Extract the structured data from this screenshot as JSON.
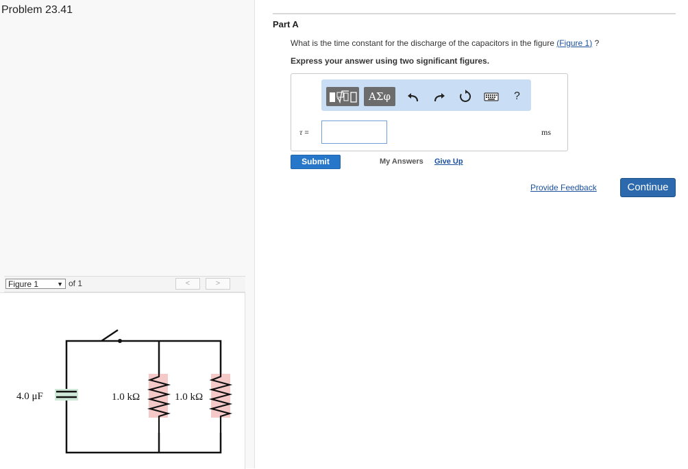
{
  "problem": {
    "title": "Problem 23.41"
  },
  "figure_nav": {
    "selected": "Figure 1",
    "of_text": "of 1",
    "prev": "<",
    "next": ">"
  },
  "circuit": {
    "capacitor_label": "4.0 μF",
    "resistor1_label": "1.0 kΩ",
    "resistor2_label": "1.0 kΩ"
  },
  "part": {
    "label": "Part A",
    "question_before": "What is the time constant for the discharge of the capacitors in the figure ",
    "question_link_open": "(",
    "question_link": "Figure 1",
    "question_link_close": ")",
    "question_after": " ?",
    "instruction": "Express your answer using two significant figures."
  },
  "answer": {
    "greek_label": "ΑΣφ",
    "help_label": "?",
    "variable": "τ",
    "equals": "=",
    "value": "",
    "unit": "ms"
  },
  "actions": {
    "submit": "Submit",
    "my_answers": "My Answers",
    "give_up": "Give Up",
    "provide_feedback": "Provide Feedback",
    "continue": "Continue"
  },
  "colors": {
    "accent_blue": "#2677c9",
    "continue_blue": "#2c69ad",
    "link_blue": "#1a4f9c",
    "toolbar_bg": "#c9def4",
    "resistor_fill": "#f6c9c9",
    "capacitor_fill": "#cfe8d8"
  }
}
